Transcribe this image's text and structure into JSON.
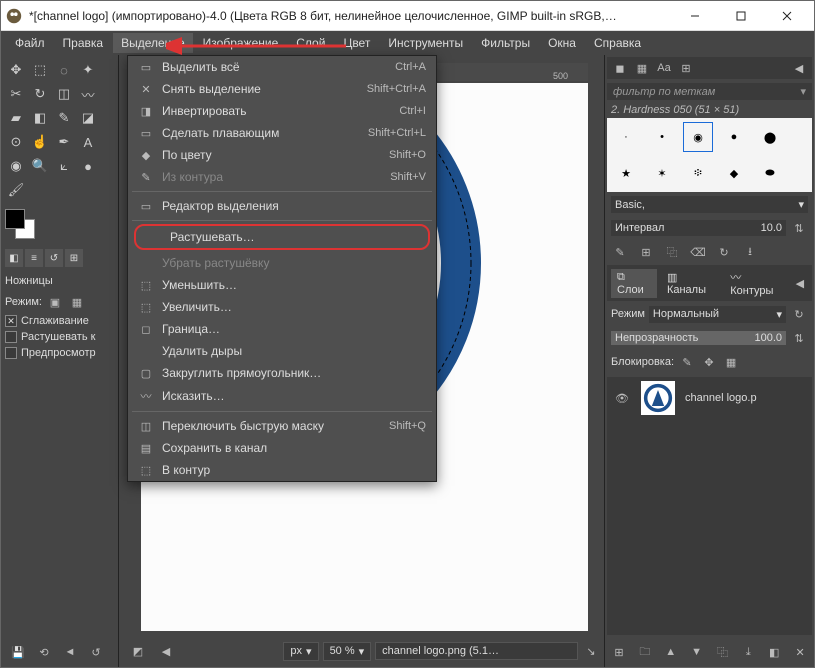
{
  "window": {
    "title": "*[channel logo] (импортировано)-4.0 (Цвета RGB 8 бит, нелинейное целочисленное, GIMP built-in sRGB,…"
  },
  "menubar": {
    "items": [
      "Файл",
      "Правка",
      "Выделение",
      "Изображение",
      "Слой",
      "Цвет",
      "Инструменты",
      "Фильтры",
      "Окна",
      "Справка"
    ],
    "active_index": 2
  },
  "dropdown": {
    "sections": [
      [
        {
          "icon": "▭",
          "label": "Выделить всё",
          "shortcut": "Ctrl+A"
        },
        {
          "icon": "✕",
          "label": "Снять выделение",
          "shortcut": "Shift+Ctrl+A"
        },
        {
          "icon": "◨",
          "label": "Инвертировать",
          "shortcut": "Ctrl+I"
        },
        {
          "icon": "▭",
          "label": "Сделать плавающим",
          "shortcut": "Shift+Ctrl+L"
        },
        {
          "icon": "◆",
          "label": "По цвету",
          "shortcut": "Shift+O"
        },
        {
          "icon": "✎",
          "label": "Из контура",
          "shortcut": "Shift+V",
          "disabled": true
        }
      ],
      [
        {
          "icon": "▭",
          "label": "Редактор выделения",
          "shortcut": ""
        }
      ],
      [
        {
          "icon": "",
          "label": "Растушевать…",
          "shortcut": "",
          "highlight": true
        },
        {
          "icon": "",
          "label": "Убрать растушёвку",
          "shortcut": "",
          "disabled": true
        },
        {
          "icon": "⬚",
          "label": "Уменьшить…",
          "shortcut": ""
        },
        {
          "icon": "⬚",
          "label": "Увеличить…",
          "shortcut": ""
        },
        {
          "icon": "◻",
          "label": "Граница…",
          "shortcut": ""
        },
        {
          "icon": "",
          "label": "Удалить дыры",
          "shortcut": ""
        },
        {
          "icon": "▢",
          "label": "Закруглить прямоугольник…",
          "shortcut": ""
        },
        {
          "icon": "〰",
          "label": "Исказить…",
          "shortcut": ""
        }
      ],
      [
        {
          "icon": "◫",
          "label": "Переключить быструю маску",
          "shortcut": "Shift+Q"
        },
        {
          "icon": "▤",
          "label": "Сохранить в канал",
          "shortcut": ""
        },
        {
          "icon": "⬚",
          "label": "В контур",
          "shortcut": ""
        }
      ]
    ]
  },
  "toolbox": {
    "title": "Ножницы",
    "mode_label": "Режим:",
    "opt_antialias": "Сглаживание",
    "opt_feather": "Растушевать к",
    "opt_preview": "Предпросмотр"
  },
  "ruler": {
    "tick": "500"
  },
  "status": {
    "unit": "px",
    "zoom": "50 %",
    "file": "channel logo.png (5.1…"
  },
  "brushes_panel": {
    "filter_placeholder": "фильтр по меткам",
    "current": "2. Hardness 050 (51 × 51)",
    "preset_label": "Basic,",
    "spacing_label": "Интервал",
    "spacing_value": "10.0"
  },
  "layers_panel": {
    "tabs": [
      "Слои",
      "Каналы",
      "Контуры"
    ],
    "active_tab": 0,
    "mode_label": "Режим",
    "mode_value": "Нормальный",
    "opacity_label": "Непрозрачность",
    "opacity_value": "100.0",
    "lock_label": "Блокировка:",
    "layer_name": "channel logo.p"
  }
}
